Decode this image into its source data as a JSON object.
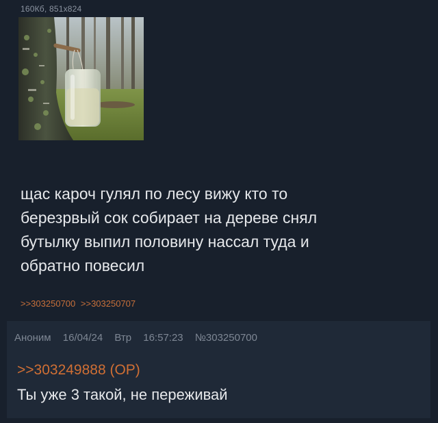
{
  "post": {
    "file_info": "160Кб, 851x824",
    "text_lines": [
      "щас кароч гулял по лесу вижу кто то",
      "березрвый сок собирает на дереве снял",
      "бутылку выпил половину нассал туда и",
      "обратно повесил"
    ],
    "replies": [
      ">>303250700",
      ">>303250707"
    ]
  },
  "reply": {
    "author": "Аноним",
    "date": "16/04/24",
    "weekday": "Втр",
    "time": "16:57:23",
    "post_number": "№303250700",
    "quote": ">>303249888 (OP)",
    "body": "Ты уже 3 такой, не переживай"
  },
  "colors": {
    "background": "#18202c",
    "reply_background": "#1f2937",
    "link": "#c8703a",
    "meta_text": "#7e8794"
  }
}
